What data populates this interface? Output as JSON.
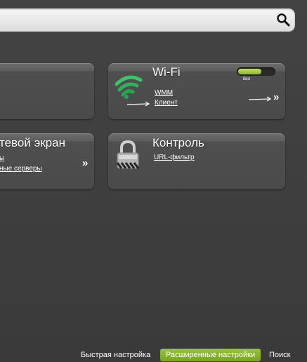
{
  "search": {
    "icon": "search-icon"
  },
  "cards": {
    "left_top": {
      "title": ""
    },
    "wifi": {
      "title": "Wi-Fi",
      "links": [
        "WMM",
        "Клиент"
      ],
      "more": "»",
      "toggle_label": "Вкл",
      "toggle_on": true,
      "icon": "wifi-icon"
    },
    "firewall": {
      "title": "тевой экран",
      "links": [
        "ы",
        "ные серверы"
      ],
      "more": "»"
    },
    "control": {
      "title": "Контроль",
      "links": [
        "URL-фильтр"
      ],
      "icon": "lock-icon"
    }
  },
  "footer": {
    "quick": "Быстрая настройка",
    "advanced": "Расширенные настройки",
    "search": "Поиск"
  },
  "colors": {
    "accent": "#8ab82c",
    "background": "#3d3d3d"
  }
}
